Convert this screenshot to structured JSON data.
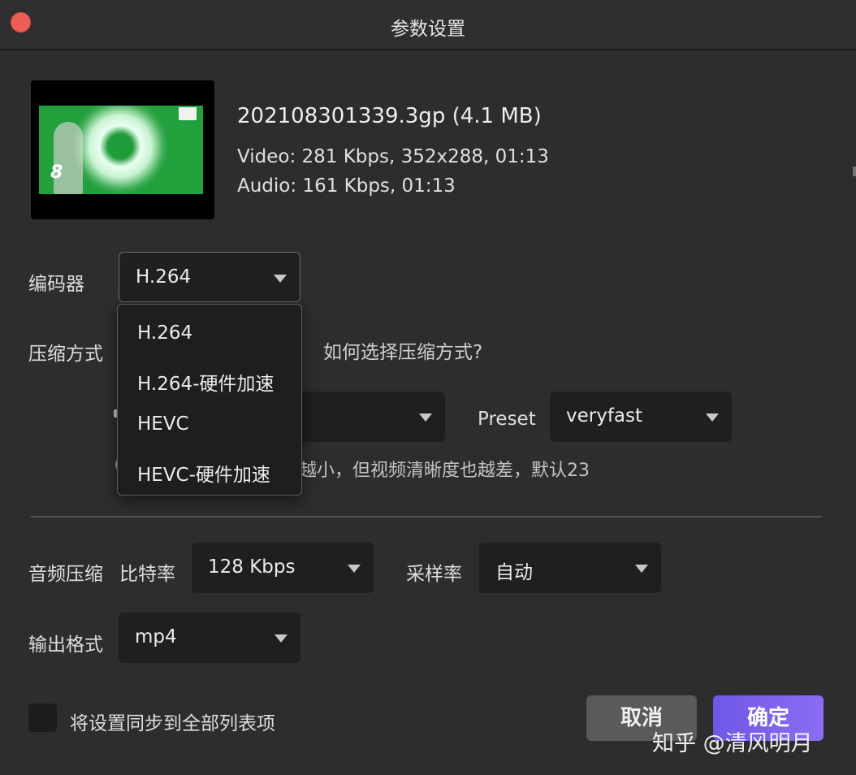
{
  "window": {
    "title": "参数设置"
  },
  "file": {
    "name_size": "202108301339.3gp  (4.1 MB)",
    "video_info": "Video: 281 Kbps, 352x288, 01:13",
    "audio_info": "Audio: 161 Kbps, 01:13"
  },
  "encoder": {
    "label": "编码器",
    "value": "H.264",
    "options": [
      "H.264",
      "H.264-硬件加速",
      "HEVC",
      "HEVC-硬件加速"
    ]
  },
  "compression": {
    "label": "压缩方式",
    "help_link": "如何选择压缩方式?",
    "hint": "越小，但视频清晰度也越差，默认23"
  },
  "preset": {
    "label": "Preset",
    "value": "veryfast"
  },
  "audio": {
    "label": "音频压缩",
    "bitrate_label": "比特率",
    "bitrate_value": "128 Kbps",
    "samplerate_label": "采样率",
    "samplerate_value": "自动"
  },
  "output": {
    "label": "输出格式",
    "value": "mp4"
  },
  "sync": {
    "label": "将设置同步到全部列表项",
    "checked": false
  },
  "buttons": {
    "cancel": "取消",
    "ok": "确定"
  },
  "watermark": "知乎 @清风明月",
  "colors": {
    "accent": "#7b61ec",
    "close": "#ee5e55",
    "background": "#2d2d2f"
  }
}
